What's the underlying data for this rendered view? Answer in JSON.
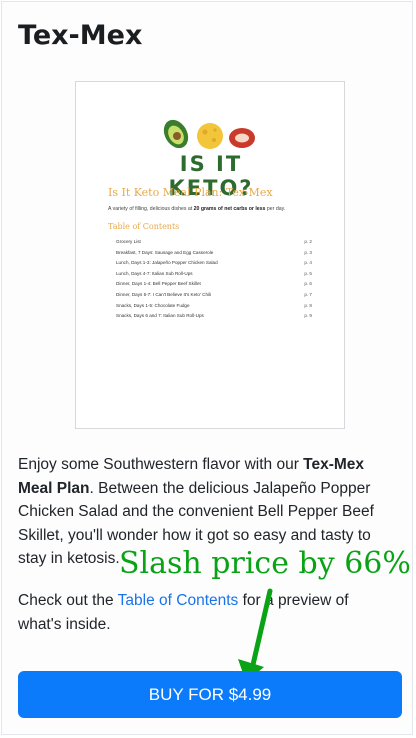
{
  "page": {
    "title": "Tex-Mex"
  },
  "preview": {
    "logo_text": "IS IT KETO?",
    "doc_title": "Is It Keto Meal Plan: Tex-Mex",
    "intro_prefix": "A variety of filling, delicious dishes at ",
    "intro_bold": "20 grams of net carbs or less",
    "intro_suffix": " per day.",
    "toc_heading": "Table of Contents",
    "toc": [
      {
        "label": "Grocery List",
        "page": "p. 2"
      },
      {
        "label": "Breakfast, 7 Days: Sausage and Egg Casserole",
        "page": "p. 3"
      },
      {
        "label": "Lunch, Days 1-3: Jalapeño Popper Chicken Salad",
        "page": "p. 4"
      },
      {
        "label": "Lunch, Days 4-7: Italian Sub Roll-Ups",
        "page": "p. 5"
      },
      {
        "label": "Dinner, Days 1-4: Bell Pepper Beef Skillet",
        "page": "p. 6"
      },
      {
        "label": "Dinner, Days 5-7: I Can't Believe It's Keto' Chili",
        "page": "p. 7"
      },
      {
        "label": "Snacks, Days 1-5: Chocolate Fudge",
        "page": "p. 8"
      },
      {
        "label": "Snacks, Days 6 and 7: Italian Sub Roll-Ups",
        "page": "p. 9"
      }
    ]
  },
  "description": {
    "p1_before": "Enjoy some Southwestern flavor with our ",
    "p1_bold": "Tex-Mex Meal Plan",
    "p1_after": ". Between the delicious Jalapeño Popper Chicken Salad and the convenient Bell Pepper Beef Skillet, you'll wonder how it got so easy and tasty to stay in ketosis.",
    "p2_before": "Check out the ",
    "p2_link": "Table of Contents",
    "p2_after": " for a preview of what's inside."
  },
  "annotation": {
    "text": "Slash price by 66%",
    "color": "#0aa316"
  },
  "buy_button": {
    "label": "BUY FOR $4.99",
    "color": "#0b7bfb"
  }
}
